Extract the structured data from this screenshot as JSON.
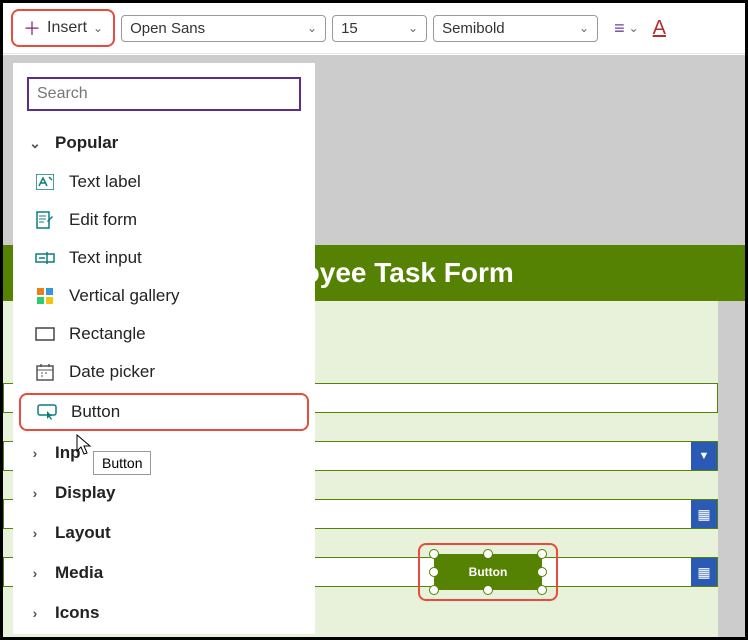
{
  "toolbar": {
    "insert_label": "Insert",
    "font": "Open Sans",
    "size": "15",
    "weight": "Semibold"
  },
  "panel": {
    "search_placeholder": "Search",
    "categories": {
      "popular": "Popular",
      "input": "Inp",
      "display": "Display",
      "layout": "Layout",
      "media": "Media",
      "icons": "Icons"
    },
    "items": {
      "text_label": "Text label",
      "edit_form": "Edit form",
      "text_input": "Text input",
      "vertical_gallery": "Vertical gallery",
      "rectangle": "Rectangle",
      "date_picker": "Date picker",
      "button": "Button"
    },
    "tooltip": "Button"
  },
  "canvas": {
    "header": "Employee Task Form",
    "selected_button_label": "Button"
  }
}
